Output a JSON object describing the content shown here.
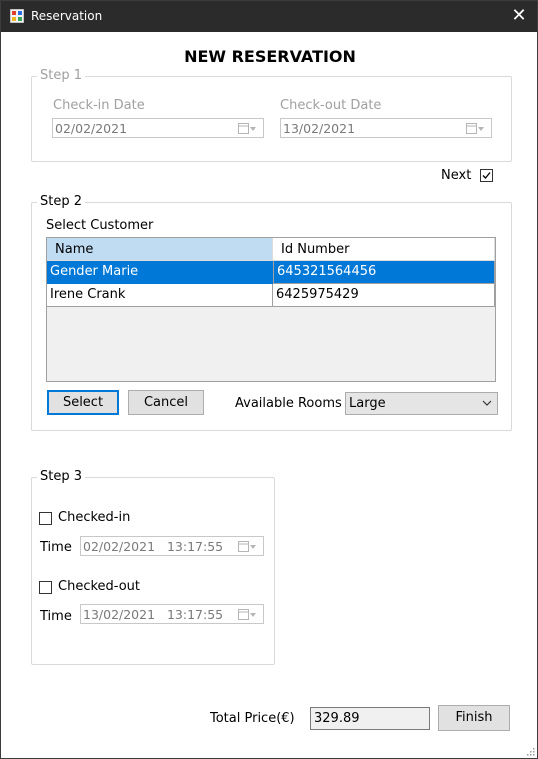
{
  "window": {
    "title": "Reservation",
    "close_glyph": "✕"
  },
  "heading": "NEW RESERVATION",
  "step1": {
    "legend": "Step 1",
    "checkin_label": "Check-in Date",
    "checkin_value": "02/02/2021",
    "checkout_label": "Check-out Date",
    "checkout_value": "13/02/2021"
  },
  "next": {
    "label": "Next",
    "checked": true
  },
  "step2": {
    "legend": "Step 2",
    "select_customer_label": "Select Customer",
    "columns": [
      "Name",
      "Id Number"
    ],
    "rows": [
      {
        "name": "Gender Marie",
        "id": "645321564456",
        "selected": true
      },
      {
        "name": "Irene Crank",
        "id": "6425975429",
        "selected": false
      }
    ],
    "select_button": "Select",
    "cancel_button": "Cancel",
    "available_rooms_label": "Available Rooms",
    "available_rooms_value": "Large"
  },
  "step3": {
    "legend": "Step 3",
    "checked_in_label": "Checked-in",
    "checked_out_label": "Checked-out",
    "time_label": "Time",
    "checkin_time": "02/02/2021   13:17:55",
    "checkout_time": "13/02/2021   13:17:55"
  },
  "footer": {
    "total_label": "Total Price(€)",
    "total_value": "329.89",
    "finish_button": "Finish"
  },
  "colors": {
    "titlebar": "#2b2b2b",
    "selection": "#0078d7",
    "header_selected": "#bfdcf3"
  },
  "icons": [
    "app-icon",
    "close-icon",
    "calendar-icon",
    "checkbox-icon",
    "dropdown-arrow-icon",
    "resize-grip-icon"
  ]
}
